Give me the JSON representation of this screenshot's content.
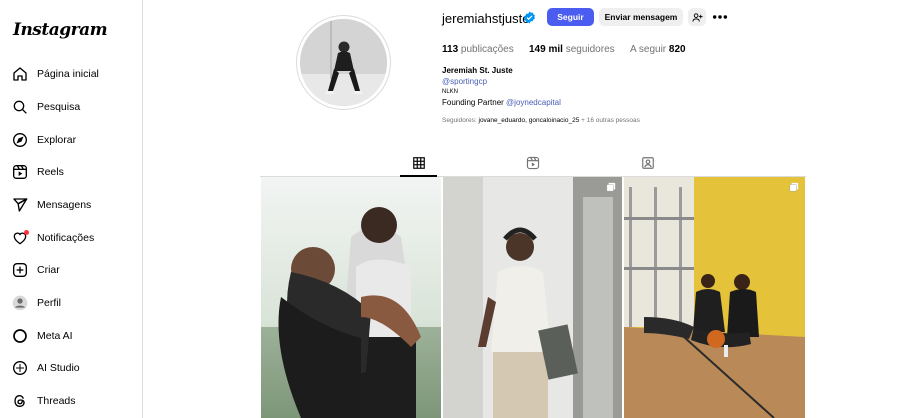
{
  "app": {
    "logo": "Instagram"
  },
  "sidebar": {
    "items": [
      {
        "label": "Página inicial",
        "icon": "home-icon"
      },
      {
        "label": "Pesquisa",
        "icon": "search-icon"
      },
      {
        "label": "Explorar",
        "icon": "compass-icon"
      },
      {
        "label": "Reels",
        "icon": "reels-icon"
      },
      {
        "label": "Mensagens",
        "icon": "send-icon"
      },
      {
        "label": "Notificações",
        "icon": "heart-icon"
      },
      {
        "label": "Criar",
        "icon": "plus-square-icon"
      },
      {
        "label": "Perfil",
        "icon": "profile-avatar-icon"
      },
      {
        "label": "Meta AI",
        "icon": "meta-ai-icon"
      },
      {
        "label": "AI Studio",
        "icon": "ai-studio-icon"
      },
      {
        "label": "Threads",
        "icon": "threads-icon"
      }
    ]
  },
  "profile": {
    "username": "jeremiahstjuste",
    "verified": true,
    "follow_label": "Seguir",
    "message_label": "Enviar mensagem",
    "stats": {
      "posts_count": "113",
      "posts_label": "publicações",
      "followers_count": "149 mil",
      "followers_label": "seguidores",
      "following_label": "A seguir",
      "following_count": "820"
    },
    "full_name": "Jeremiah St. Juste",
    "mention": "@sportingcp",
    "bio_line1": "NLKN",
    "bio_line2_prefix": "Founding Partner ",
    "bio_line2_link": "@joynedcapital",
    "followed_by_prefix": "Seguidores: ",
    "followed_by_names": "jovane_eduardo, goncaloinacio_25",
    "followed_by_suffix": " + 16 outras pessoas"
  },
  "tabs": [
    {
      "icon": "grid-icon",
      "active": true
    },
    {
      "icon": "reels-tab-icon",
      "active": false
    },
    {
      "icon": "tagged-icon",
      "active": false
    }
  ],
  "colors": {
    "accent": "#4a5df0",
    "link": "#4a5db5",
    "border": "#dbdbdb",
    "secondary_text": "#737373"
  }
}
